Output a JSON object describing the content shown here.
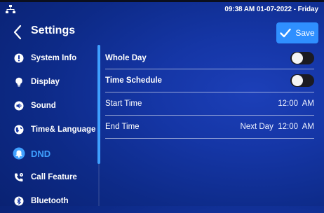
{
  "status_bar": {
    "datetime": "09:38 AM 01-07-2022 - Friday",
    "network_icon": "network-icon"
  },
  "header": {
    "title": "Settings",
    "save_label": "Save"
  },
  "sidebar": {
    "items": [
      {
        "label": "System Info",
        "icon": "info-icon",
        "active": false
      },
      {
        "label": "Display",
        "icon": "bulb-icon",
        "active": false
      },
      {
        "label": "Sound",
        "icon": "speaker-icon",
        "active": false
      },
      {
        "label": "Time& Language",
        "icon": "globe-icon",
        "active": false
      },
      {
        "label": "DND",
        "icon": "bell-icon",
        "active": true
      },
      {
        "label": "Call Feature",
        "icon": "phone-settings-icon",
        "active": false
      },
      {
        "label": "Bluetooth",
        "icon": "bluetooth-icon",
        "active": false
      }
    ]
  },
  "dnd": {
    "whole_day": {
      "label": "Whole Day",
      "enabled": false
    },
    "time_schedule": {
      "label": "Time Schedule",
      "enabled": false
    },
    "start_time": {
      "label": "Start Time",
      "value": "12:00  AM"
    },
    "end_time": {
      "label": "End Time",
      "value": "Next Day  12:00  AM"
    }
  },
  "colors": {
    "accent": "#3fa0ff",
    "save_button": "#2f8fff",
    "background": "#1536a6"
  }
}
